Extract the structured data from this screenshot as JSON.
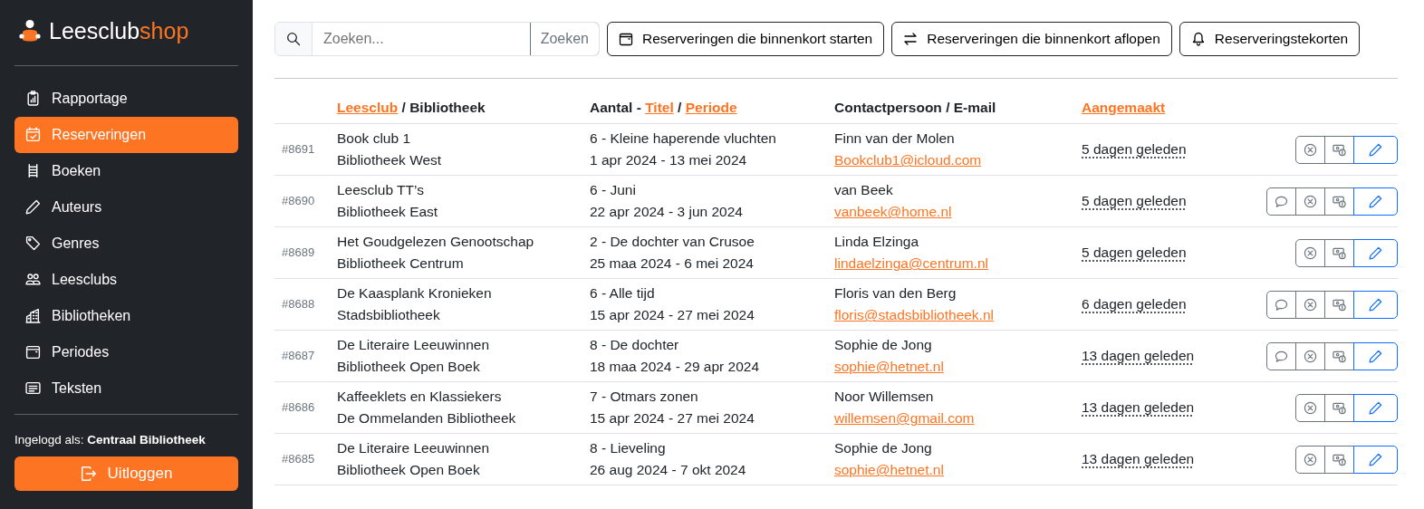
{
  "brand": {
    "part_1": "Leesclub",
    "part_2": "shop"
  },
  "sidebar": {
    "items": [
      {
        "label": "Rapportage",
        "selected": false
      },
      {
        "label": "Reserveringen",
        "selected": true
      },
      {
        "label": "Boeken",
        "selected": false
      },
      {
        "label": "Auteurs",
        "selected": false
      },
      {
        "label": "Genres",
        "selected": false
      },
      {
        "label": "Leesclubs",
        "selected": false
      },
      {
        "label": "Bibliotheken",
        "selected": false
      },
      {
        "label": "Periodes",
        "selected": false
      },
      {
        "label": "Teksten",
        "selected": false
      }
    ],
    "logged_in_label": "Ingelogd als:",
    "logged_in_user": "Centraal Bibliotheek",
    "logout": "Uitloggen"
  },
  "toolbar": {
    "search_placeholder": "Zoeken...",
    "search_button": "Zoeken",
    "buttons": [
      {
        "label": "Reserveringen die binnenkort starten"
      },
      {
        "label": "Reserveringen die binnenkort aflopen"
      },
      {
        "label": "Reserveringstekorten"
      }
    ]
  },
  "table": {
    "columns": [
      [
        {
          "text": "Leesclub",
          "sortable": true
        },
        {
          "text": "/ Bibliotheek",
          "sortable": false
        }
      ],
      [
        {
          "text": "Aantal -",
          "sortable": false
        },
        {
          "text": "Titel",
          "sortable": true
        },
        {
          "text": "/",
          "sortable": false
        },
        {
          "text": "Periode",
          "sortable": true
        }
      ],
      [
        {
          "text": "Contactpersoon / E-mail",
          "sortable": false
        }
      ],
      [
        {
          "text": "Aangemaakt",
          "sortable": true
        }
      ]
    ],
    "rows": [
      {
        "id": "#8691",
        "club": "Book club 1",
        "library": "Bibliotheek West",
        "title": "6 - Kleine haperende vluchten",
        "period": "1 apr 2024 - 13 mei 2024",
        "contact": "Finn van der Molen",
        "email": "Bookclub1@icloud.com",
        "created": "5 dagen geleden",
        "has_comment": false
      },
      {
        "id": "#8690",
        "club": "Leesclub TT’s",
        "library": "Bibliotheek East",
        "title": "6 - Juni",
        "period": "22 apr 2024 - 3 jun 2024",
        "contact": "van Beek",
        "email": "vanbeek@home.nl",
        "created": "5 dagen geleden",
        "has_comment": true
      },
      {
        "id": "#8689",
        "club": "Het Goudgelezen Genootschap",
        "library": "Bibliotheek Centrum",
        "title": "2 - De dochter van Crusoe",
        "period": "25 maa 2024 - 6 mei 2024",
        "contact": "Linda Elzinga",
        "email": "lindaelzinga@centrum.nl",
        "created": "5 dagen geleden",
        "has_comment": false
      },
      {
        "id": "#8688",
        "club": "De Kaasplank Kronieken",
        "library": "Stadsbibliotheek",
        "title": "6 - Alle tijd",
        "period": "15 apr 2024 - 27 mei 2024",
        "contact": "Floris van den Berg",
        "email": "floris@stadsbibliotheek.nl",
        "created": "6 dagen geleden",
        "has_comment": true
      },
      {
        "id": "#8687",
        "club": "De Literaire Leeuwinnen",
        "library": "Bibliotheek Open Boek",
        "title": "8 - De dochter",
        "period": "18 maa 2024 - 29 apr 2024",
        "contact": "Sophie de Jong",
        "email": "sophie@hetnet.nl",
        "created": "13 dagen geleden",
        "has_comment": true
      },
      {
        "id": "#8686",
        "club": "Kaffeeklets en Klassiekers",
        "library": "De Ommelanden Bibliotheek",
        "title": "7 - Otmars zonen",
        "period": "15 apr 2024 - 27 mei 2024",
        "contact": "Noor Willemsen",
        "email": "willemsen@gmail.com",
        "created": "13 dagen geleden",
        "has_comment": false
      },
      {
        "id": "#8685",
        "club": "De Literaire Leeuwinnen",
        "library": "Bibliotheek Open Boek",
        "title": "8 - Lieveling",
        "period": "26 aug 2024 - 7 okt 2024",
        "contact": "Sophie de Jong",
        "email": "sophie@hetnet.nl",
        "created": "13 dagen geleden",
        "has_comment": false
      }
    ]
  }
}
